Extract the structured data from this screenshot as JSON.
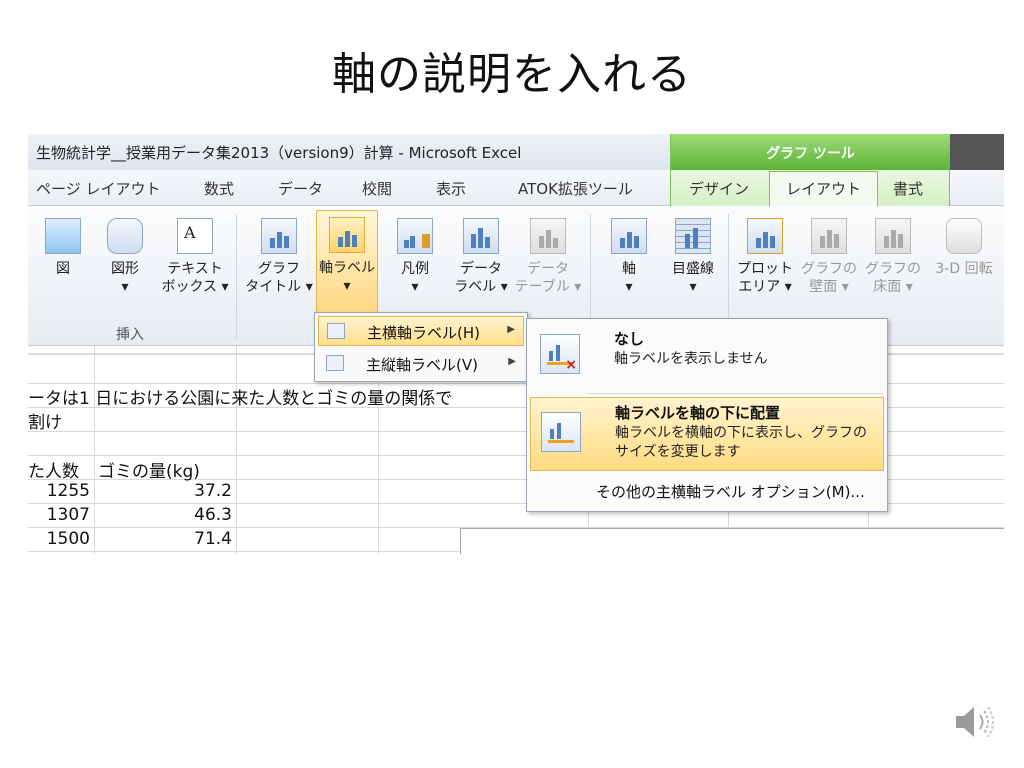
{
  "slide": {
    "title": "軸の説明を入れる"
  },
  "window": {
    "title": "生物統計学__授業用データ集2013（version9）計算 - Microsoft Excel",
    "context_group": "グラフ ツール"
  },
  "tabs": [
    "ページ レイアウト",
    "数式",
    "データ",
    "校閲",
    "表示",
    "ATOK拡張ツール"
  ],
  "context_tabs": [
    "デザイン",
    "レイアウト",
    "書式"
  ],
  "active_tab": "レイアウト",
  "ribbon": {
    "insert_group": {
      "label": "挿入",
      "buttons": [
        {
          "l1": "図",
          "l2": ""
        },
        {
          "l1": "図形",
          "l2": "▾"
        },
        {
          "l1": "テキスト",
          "l2": "ボックス ▾"
        }
      ]
    },
    "labels_group": [
      {
        "l1": "グラフ",
        "l2": "タイトル ▾"
      },
      {
        "l1": "軸ラベル",
        "l2": "▾"
      },
      {
        "l1": "凡例",
        "l2": "▾"
      },
      {
        "l1": "データ",
        "l2": "ラベル ▾"
      },
      {
        "l1": "データ",
        "l2": "テーブル ▾"
      }
    ],
    "axes_group": [
      {
        "l1": "軸",
        "l2": "▾"
      },
      {
        "l1": "目盛線",
        "l2": "▾"
      }
    ],
    "bg_group": [
      {
        "l1": "プロット",
        "l2": "エリア ▾"
      },
      {
        "l1": "グラフの",
        "l2": "壁面 ▾"
      },
      {
        "l1": "グラフの",
        "l2": "床面 ▾"
      },
      {
        "l1": "3-D 回転",
        "l2": ""
      }
    ]
  },
  "submenu": [
    {
      "label": "主横軸ラベル(H)",
      "arrow": "▶"
    },
    {
      "label": "主縦軸ラベル(V)",
      "arrow": "▶"
    }
  ],
  "options_menu": {
    "none": {
      "title": "なし",
      "desc": "軸ラベルを表示しません"
    },
    "below": {
      "title": "軸ラベルを軸の下に配置",
      "desc1": "軸ラベルを横軸の下に表示し、グラフの",
      "desc2": "サイズを変更します"
    },
    "more": "その他の主横軸ラベル オプション(M)..."
  },
  "sheet": {
    "row2": "ータは1 日における公園に来た人数とゴミの量の関係で",
    "row3": "割け",
    "header_a": "た人数",
    "header_b": "ゴミの量(kg)",
    "rows": [
      {
        "a": "1255",
        "b": "37.2"
      },
      {
        "a": "1307",
        "b": "46.3"
      },
      {
        "a": "1500",
        "b": "71.4"
      }
    ]
  }
}
